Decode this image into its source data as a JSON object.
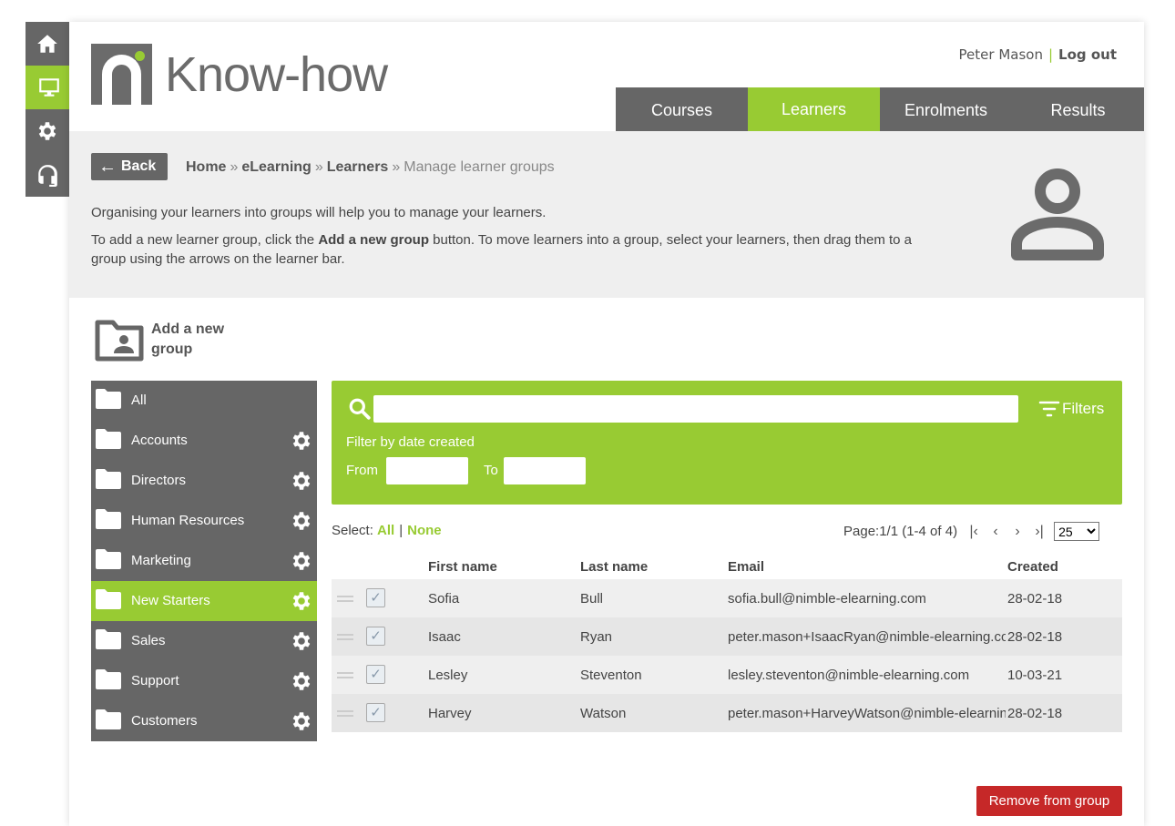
{
  "header": {
    "logo_text": "Know-how",
    "user_name": "Peter Mason",
    "logout_label": "Log out",
    "separator": "|"
  },
  "nav": {
    "tabs": [
      {
        "label": "Courses",
        "active": false
      },
      {
        "label": "Learners",
        "active": true
      },
      {
        "label": "Enrolments",
        "active": false
      },
      {
        "label": "Results",
        "active": false
      }
    ]
  },
  "rail": {
    "items": [
      "home-icon",
      "monitor-icon",
      "gear-icon",
      "headset-icon"
    ],
    "active": "monitor-icon"
  },
  "intro": {
    "back_label": "Back",
    "breadcrumb": [
      "Home",
      "eLearning",
      "Learners",
      "Manage learner groups"
    ],
    "crumb_sep": "»",
    "p1": "Organising your learners into groups will help you to manage your learners.",
    "p2_before": "To add a new learner group, click the ",
    "p2_bold": "Add a new group",
    "p2_after": " button. To move learners into a group, select your learners, then drag them to a group using the arrows on the learner bar."
  },
  "add_group": {
    "line1": "Add a new",
    "line2": "group"
  },
  "groups": [
    {
      "name": "All",
      "gear": false,
      "active": false
    },
    {
      "name": "Accounts",
      "gear": true,
      "active": false
    },
    {
      "name": "Directors",
      "gear": true,
      "active": false
    },
    {
      "name": "Human Resources",
      "gear": true,
      "active": false
    },
    {
      "name": "Marketing",
      "gear": true,
      "active": false
    },
    {
      "name": "New Starters",
      "gear": true,
      "active": true
    },
    {
      "name": "Sales",
      "gear": true,
      "active": false
    },
    {
      "name": "Support",
      "gear": true,
      "active": false
    },
    {
      "name": "Customers",
      "gear": true,
      "active": false
    }
  ],
  "search": {
    "value": "",
    "filters_label": "Filters",
    "filter_by_label": "Filter by date created",
    "from_label": "From",
    "to_label": "To"
  },
  "selection": {
    "label": "Select:",
    "all": "All",
    "none": "None",
    "sep": "|"
  },
  "pager": {
    "text": "Page:1/1 (1-4 of 4)",
    "page_size": "25",
    "page_size_options": [
      "25"
    ],
    "first": "|‹",
    "prev": "‹",
    "next": "›",
    "last": "›|"
  },
  "table": {
    "columns": [
      "First name",
      "Last name",
      "Email",
      "Created"
    ],
    "rows": [
      {
        "first": "Sofia",
        "last": "Bull",
        "email": "sofia.bull@nimble-elearning.com",
        "created": "28-02-18",
        "checked": "✓"
      },
      {
        "first": "Isaac",
        "last": "Ryan",
        "email": "peter.mason+IsaacRyan@nimble-elearning.com",
        "created": "28-02-18",
        "checked": "✓"
      },
      {
        "first": "Lesley",
        "last": "Steventon",
        "email": "lesley.steventon@nimble-elearning.com",
        "created": "10-03-21",
        "checked": "✓"
      },
      {
        "first": "Harvey",
        "last": "Watson",
        "email": "peter.mason+HarveyWatson@nimble-elearning.com",
        "created": "28-02-18",
        "checked": "✓"
      }
    ]
  },
  "actions": {
    "remove_label": "Remove from group"
  },
  "colors": {
    "accent": "#98cb33",
    "dark": "#666666",
    "danger": "#c62828"
  }
}
